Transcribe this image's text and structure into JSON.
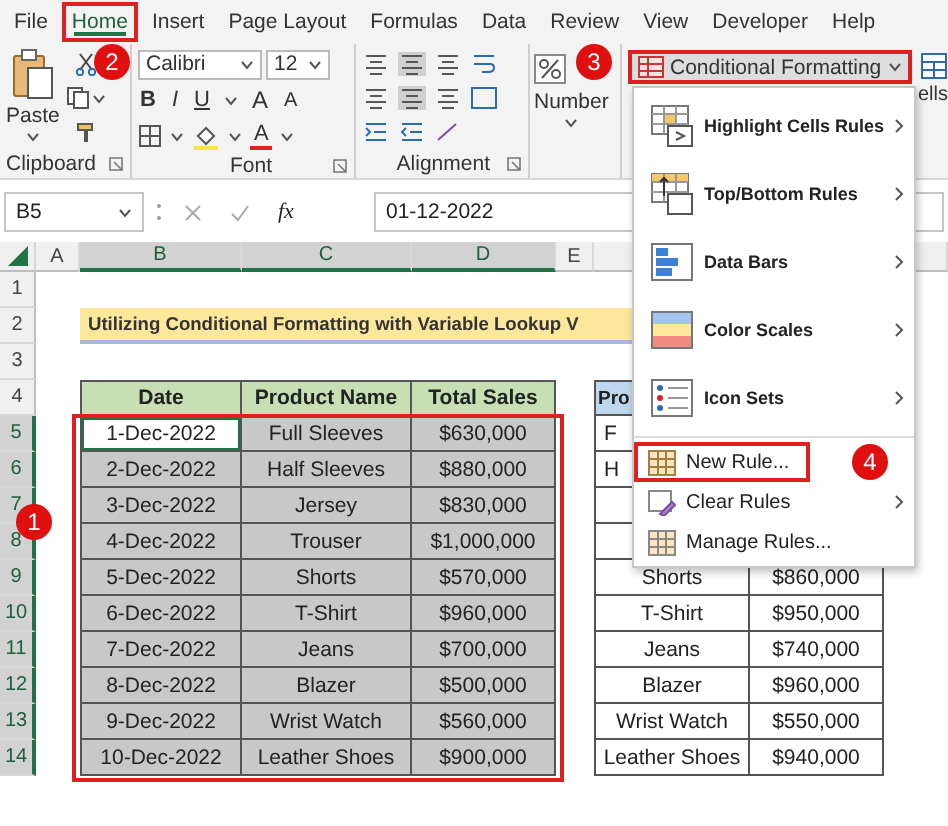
{
  "ribbon_tabs": [
    {
      "label": "File",
      "selected": false,
      "highlighted": false
    },
    {
      "label": "Home",
      "selected": true,
      "highlighted": true
    },
    {
      "label": "Insert",
      "selected": false,
      "highlighted": false
    },
    {
      "label": "Page Layout",
      "selected": false,
      "highlighted": false
    },
    {
      "label": "Formulas",
      "selected": false,
      "highlighted": false
    },
    {
      "label": "Data",
      "selected": false,
      "highlighted": false
    },
    {
      "label": "Review",
      "selected": false,
      "highlighted": false
    },
    {
      "label": "View",
      "selected": false,
      "highlighted": false
    },
    {
      "label": "Developer",
      "selected": false,
      "highlighted": false
    },
    {
      "label": "Help",
      "selected": false,
      "highlighted": false
    }
  ],
  "ribbon": {
    "clipboard": {
      "paste": "Paste",
      "label": "Clipboard"
    },
    "font": {
      "name": "Calibri",
      "size": "12",
      "format_buttons": [
        "B",
        "I",
        "U"
      ],
      "size_buttons": [
        "A",
        "A"
      ],
      "color_button": "A",
      "label": "Font"
    },
    "alignment": {
      "label": "Alignment"
    },
    "number": {
      "label": "Number"
    },
    "conditional_formatting": {
      "label": "Conditional Formatting",
      "highlighted": true
    },
    "cells": {
      "label": "ells"
    }
  },
  "formula_bar": {
    "name_box": "B5",
    "function_label": "fx",
    "value": "01-12-2022"
  },
  "column_headers": [
    "A",
    "B",
    "C",
    "D",
    "E"
  ],
  "row_numbers": [
    "1",
    "2",
    "3",
    "4",
    "5",
    "6",
    "7",
    "8",
    "9",
    "10",
    "11",
    "12",
    "13",
    "14"
  ],
  "title": "Utilizing Conditional Formatting with Variable Lookup V",
  "sales_table": {
    "highlighted": true,
    "columns": [
      "Date",
      "Product Name",
      "Total Sales"
    ],
    "rows": [
      {
        "date": "1-Dec-2022",
        "product": "Full Sleeves",
        "sales": "$630,000",
        "active": true
      },
      {
        "date": "2-Dec-2022",
        "product": "Half Sleeves",
        "sales": "$880,000",
        "active": false
      },
      {
        "date": "3-Dec-2022",
        "product": "Jersey",
        "sales": "$830,000",
        "active": false
      },
      {
        "date": "4-Dec-2022",
        "product": "Trouser",
        "sales": "$1,000,000",
        "active": false
      },
      {
        "date": "5-Dec-2022",
        "product": "Shorts",
        "sales": "$570,000",
        "active": false
      },
      {
        "date": "6-Dec-2022",
        "product": "T-Shirt",
        "sales": "$960,000",
        "active": false
      },
      {
        "date": "7-Dec-2022",
        "product": "Jeans",
        "sales": "$700,000",
        "active": false
      },
      {
        "date": "8-Dec-2022",
        "product": "Blazer",
        "sales": "$500,000",
        "active": false
      },
      {
        "date": "9-Dec-2022",
        "product": "Wrist Watch",
        "sales": "$560,000",
        "active": false
      },
      {
        "date": "10-Dec-2022",
        "product": "Leather Shoes",
        "sales": "$900,000",
        "active": false
      }
    ]
  },
  "lookup_table": {
    "column_1": "Pro",
    "rows": [
      {
        "product": "F"
      },
      {
        "product": "H"
      },
      {},
      {},
      {
        "product": "Shorts",
        "sales": "$860,000"
      },
      {
        "product": "T-Shirt",
        "sales": "$950,000"
      },
      {
        "product": "Jeans",
        "sales": "$740,000"
      },
      {
        "product": "Blazer",
        "sales": "$960,000"
      },
      {
        "product": "Wrist Watch",
        "sales": "$550,000"
      },
      {
        "product": "Leather Shoes",
        "sales": "$940,000"
      }
    ]
  },
  "conditional_formatting_menu": {
    "items": [
      {
        "label": "Highlight Cells Rules",
        "kind": "large",
        "submenu": true,
        "highlighted": false
      },
      {
        "label": "Top/Bottom Rules",
        "kind": "large",
        "submenu": true,
        "highlighted": false
      },
      {
        "label": "Data Bars",
        "kind": "large",
        "submenu": true,
        "highlighted": false
      },
      {
        "label": "Color Scales",
        "kind": "large",
        "submenu": true,
        "highlighted": false
      },
      {
        "label": "Icon Sets",
        "kind": "large",
        "submenu": true,
        "highlighted": false
      },
      {
        "label": "New Rule...",
        "kind": "small",
        "submenu": false,
        "highlighted": true
      },
      {
        "label": "Clear Rules",
        "kind": "small",
        "submenu": true,
        "highlighted": false
      },
      {
        "label": "Manage Rules...",
        "kind": "small",
        "submenu": false,
        "highlighted": false
      }
    ]
  },
  "callouts": [
    {
      "label": "1"
    },
    {
      "label": "2"
    },
    {
      "label": "3"
    },
    {
      "label": "4"
    }
  ]
}
